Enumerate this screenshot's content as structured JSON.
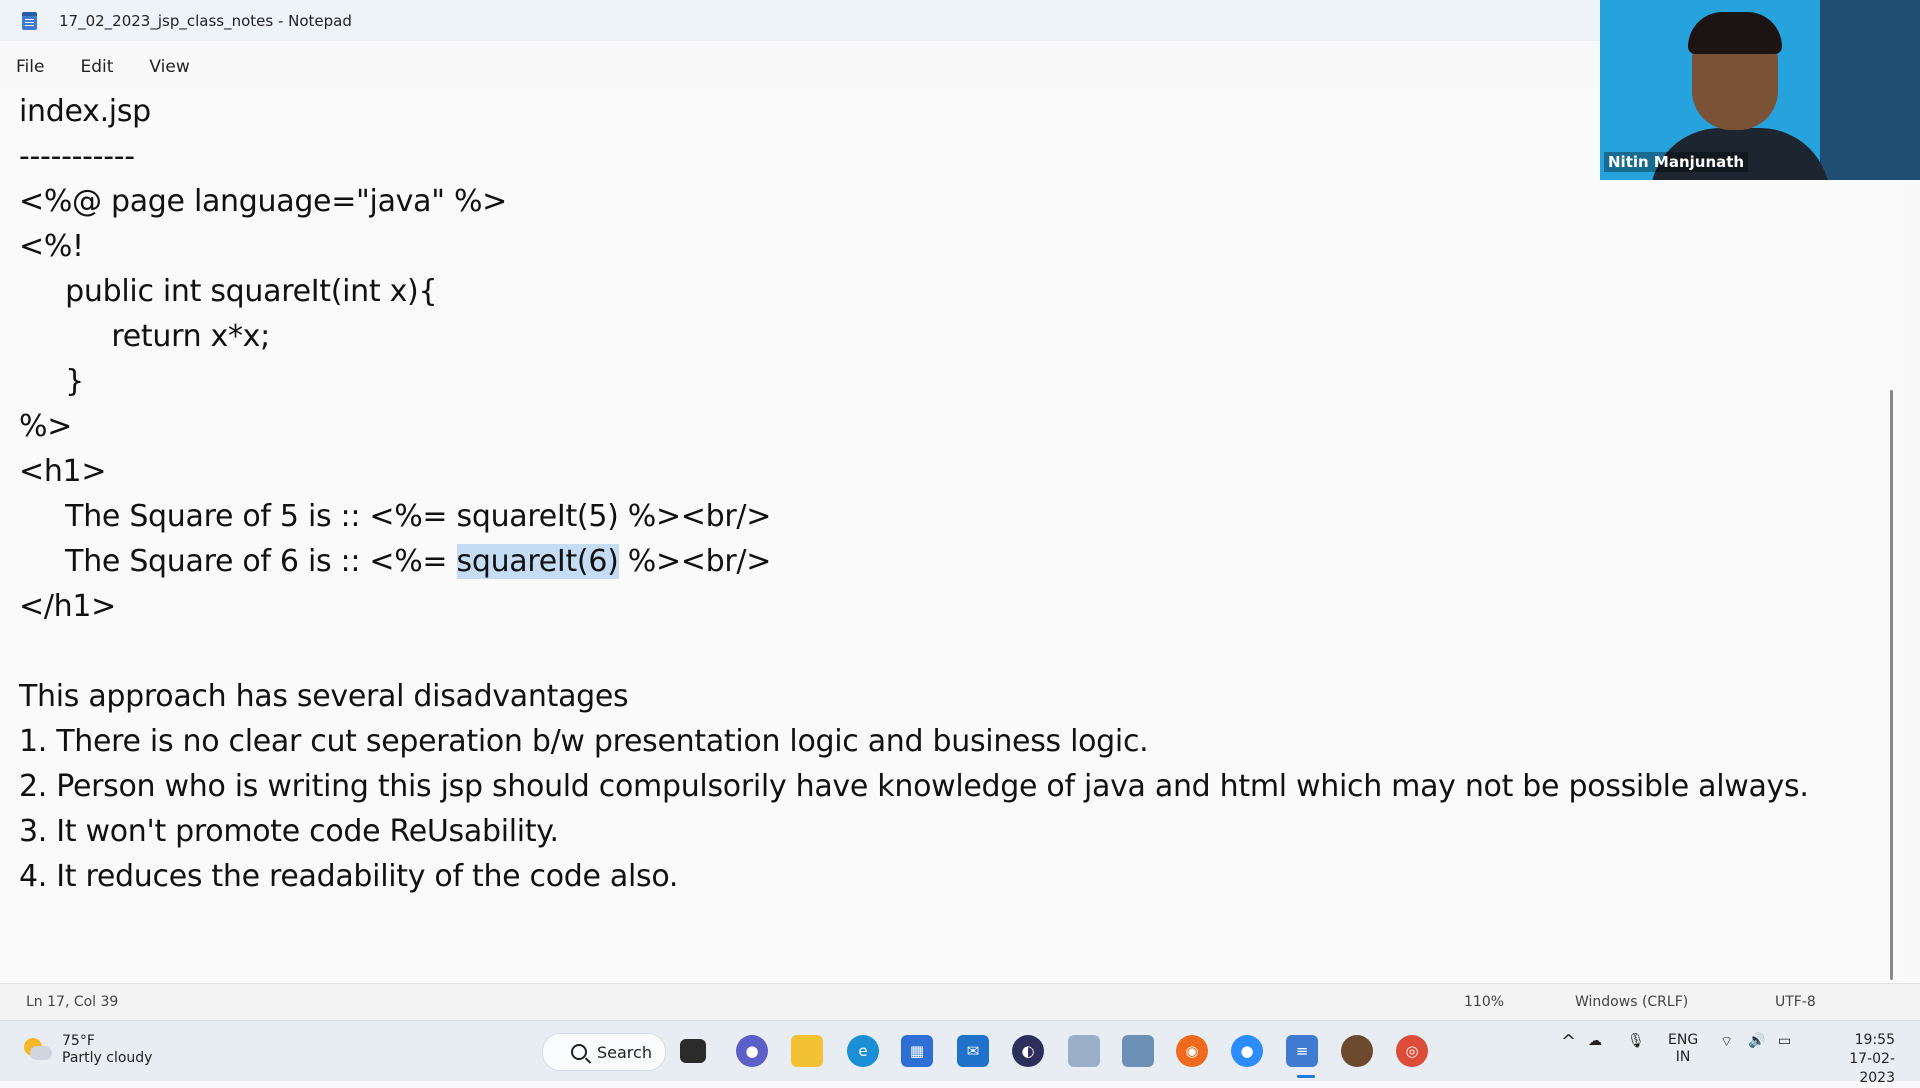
{
  "window": {
    "title": "17_02_2023_jsp_class_notes - Notepad",
    "menu": [
      "File",
      "Edit",
      "View"
    ]
  },
  "editor": {
    "lines": [
      "index.jsp",
      "-----------",
      "<%@ page language=\"java\" %>",
      "<%!",
      "     public int squareIt(int x){",
      "          return x*x;",
      "     }",
      "%>",
      "<h1>",
      "     The Square of 5 is :: <%= squareIt(5) %><br/>",
      "",
      "</h1>",
      "",
      "This approach has several disadvantages",
      "1. There is no clear cut seperation b/w presentation logic and business logic.",
      "2. Person who is writing this jsp should compulsorily have knowledge of java and html which may not be possible always.",
      "3. It won't promote code ReUsability.",
      "4. It reduces the readability of the code also."
    ],
    "selected_line": {
      "before": "     The Square of 6 is :: <%= ",
      "selection": "squareIt(6)",
      "after": " %><br/>"
    }
  },
  "webcam": {
    "name": "Nitin Manjunath"
  },
  "status": {
    "position": "Ln 17, Col 39",
    "zoom": "110%",
    "line_ending": "Windows (CRLF)",
    "encoding": "UTF-8"
  },
  "taskbar": {
    "weather_temp": "75°F",
    "weather_desc": "Partly cloudy",
    "search_label": "Search",
    "lang_top": "ENG",
    "lang_bottom": "IN",
    "time": "19:55",
    "date": "17-02-2023"
  }
}
